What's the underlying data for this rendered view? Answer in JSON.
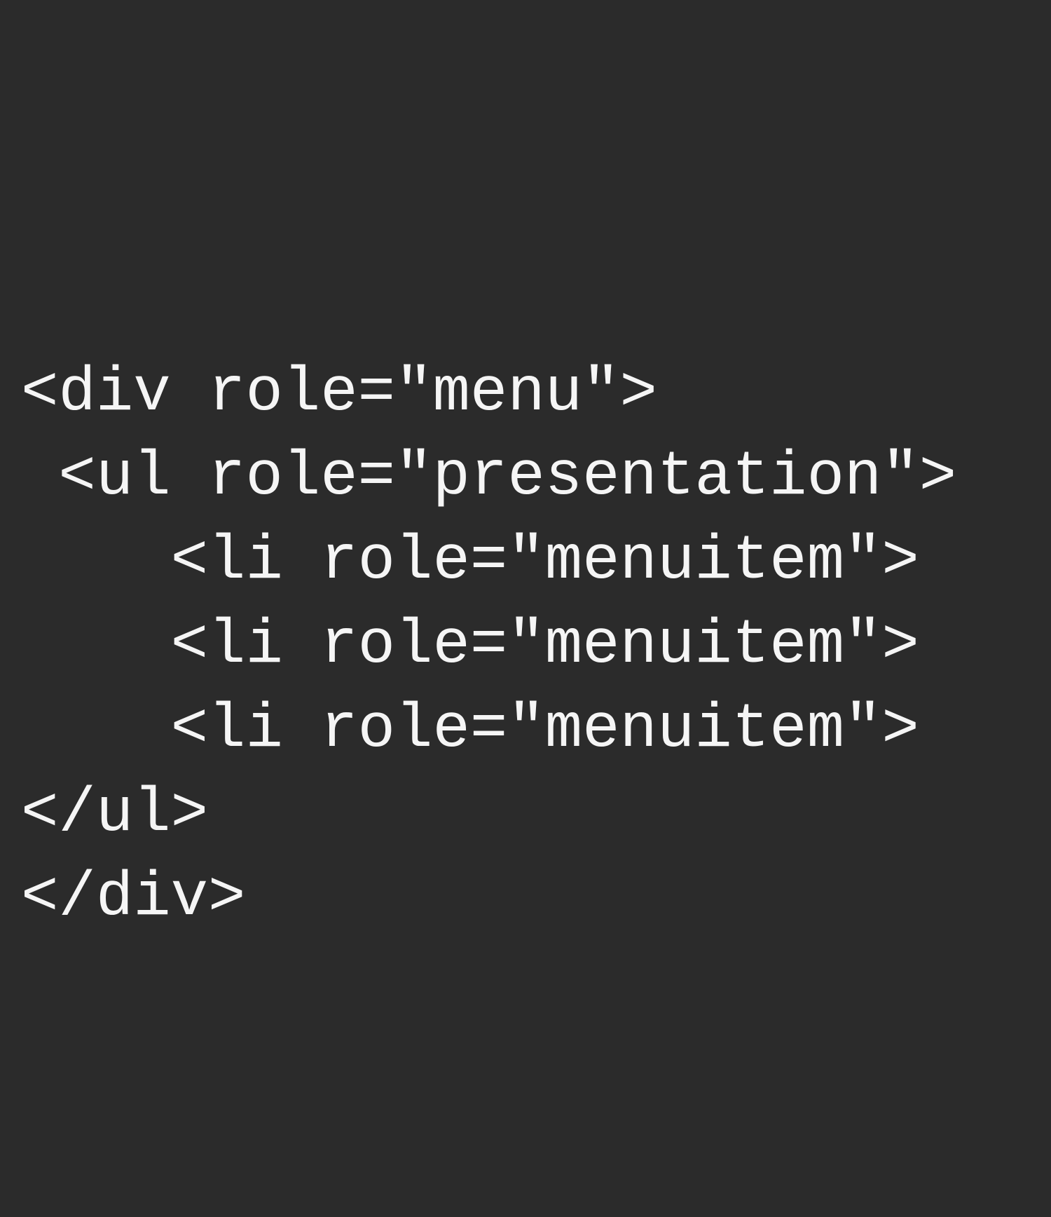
{
  "code": {
    "lines": [
      "<div role=\"menu\">",
      " <ul role=\"presentation\">",
      "    <li role=\"menuitem\">",
      "    <li role=\"menuitem\">",
      "    <li role=\"menuitem\">",
      "</ul>",
      "</div>"
    ]
  }
}
